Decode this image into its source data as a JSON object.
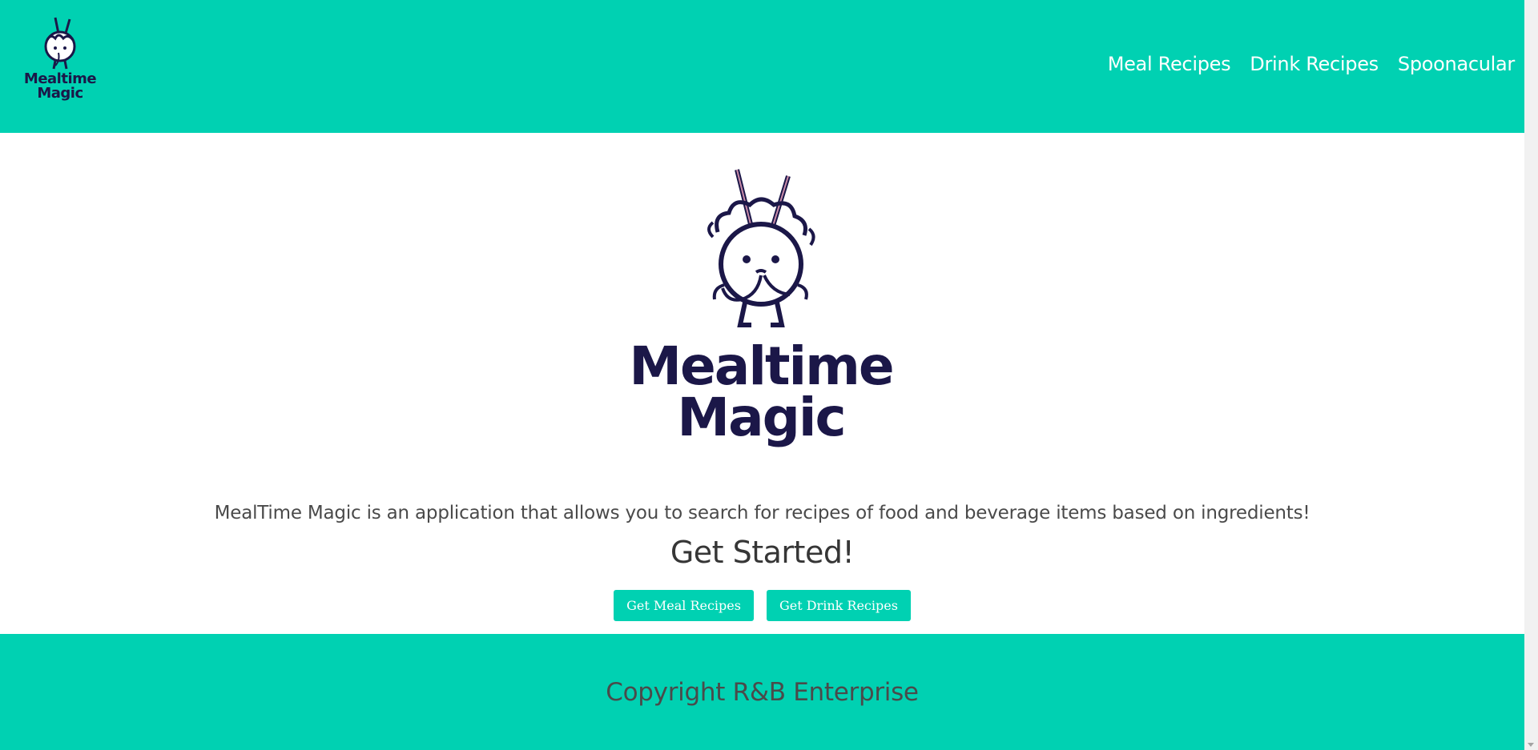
{
  "brand": {
    "logo_line1": "Mealtime",
    "logo_line2": "Magic",
    "logo_icon": "noodle-bowl-mascot-icon",
    "primary_color": "#00d1b2",
    "logo_color": "#1b1748"
  },
  "nav": {
    "items": [
      {
        "label": "Meal Recipes"
      },
      {
        "label": "Drink Recipes"
      },
      {
        "label": "Spoonacular"
      }
    ]
  },
  "hero": {
    "logo_line1": "Mealtime",
    "logo_line2": "Magic",
    "description": "MealTime Magic is an application that allows you to search for recipes of food and beverage items based on ingredients!",
    "cta_heading": "Get Started!",
    "buttons": {
      "meal": "Get Meal Recipes",
      "drink": "Get Drink Recipes"
    }
  },
  "footer": {
    "text": "Copyright R&B Enterprise"
  }
}
